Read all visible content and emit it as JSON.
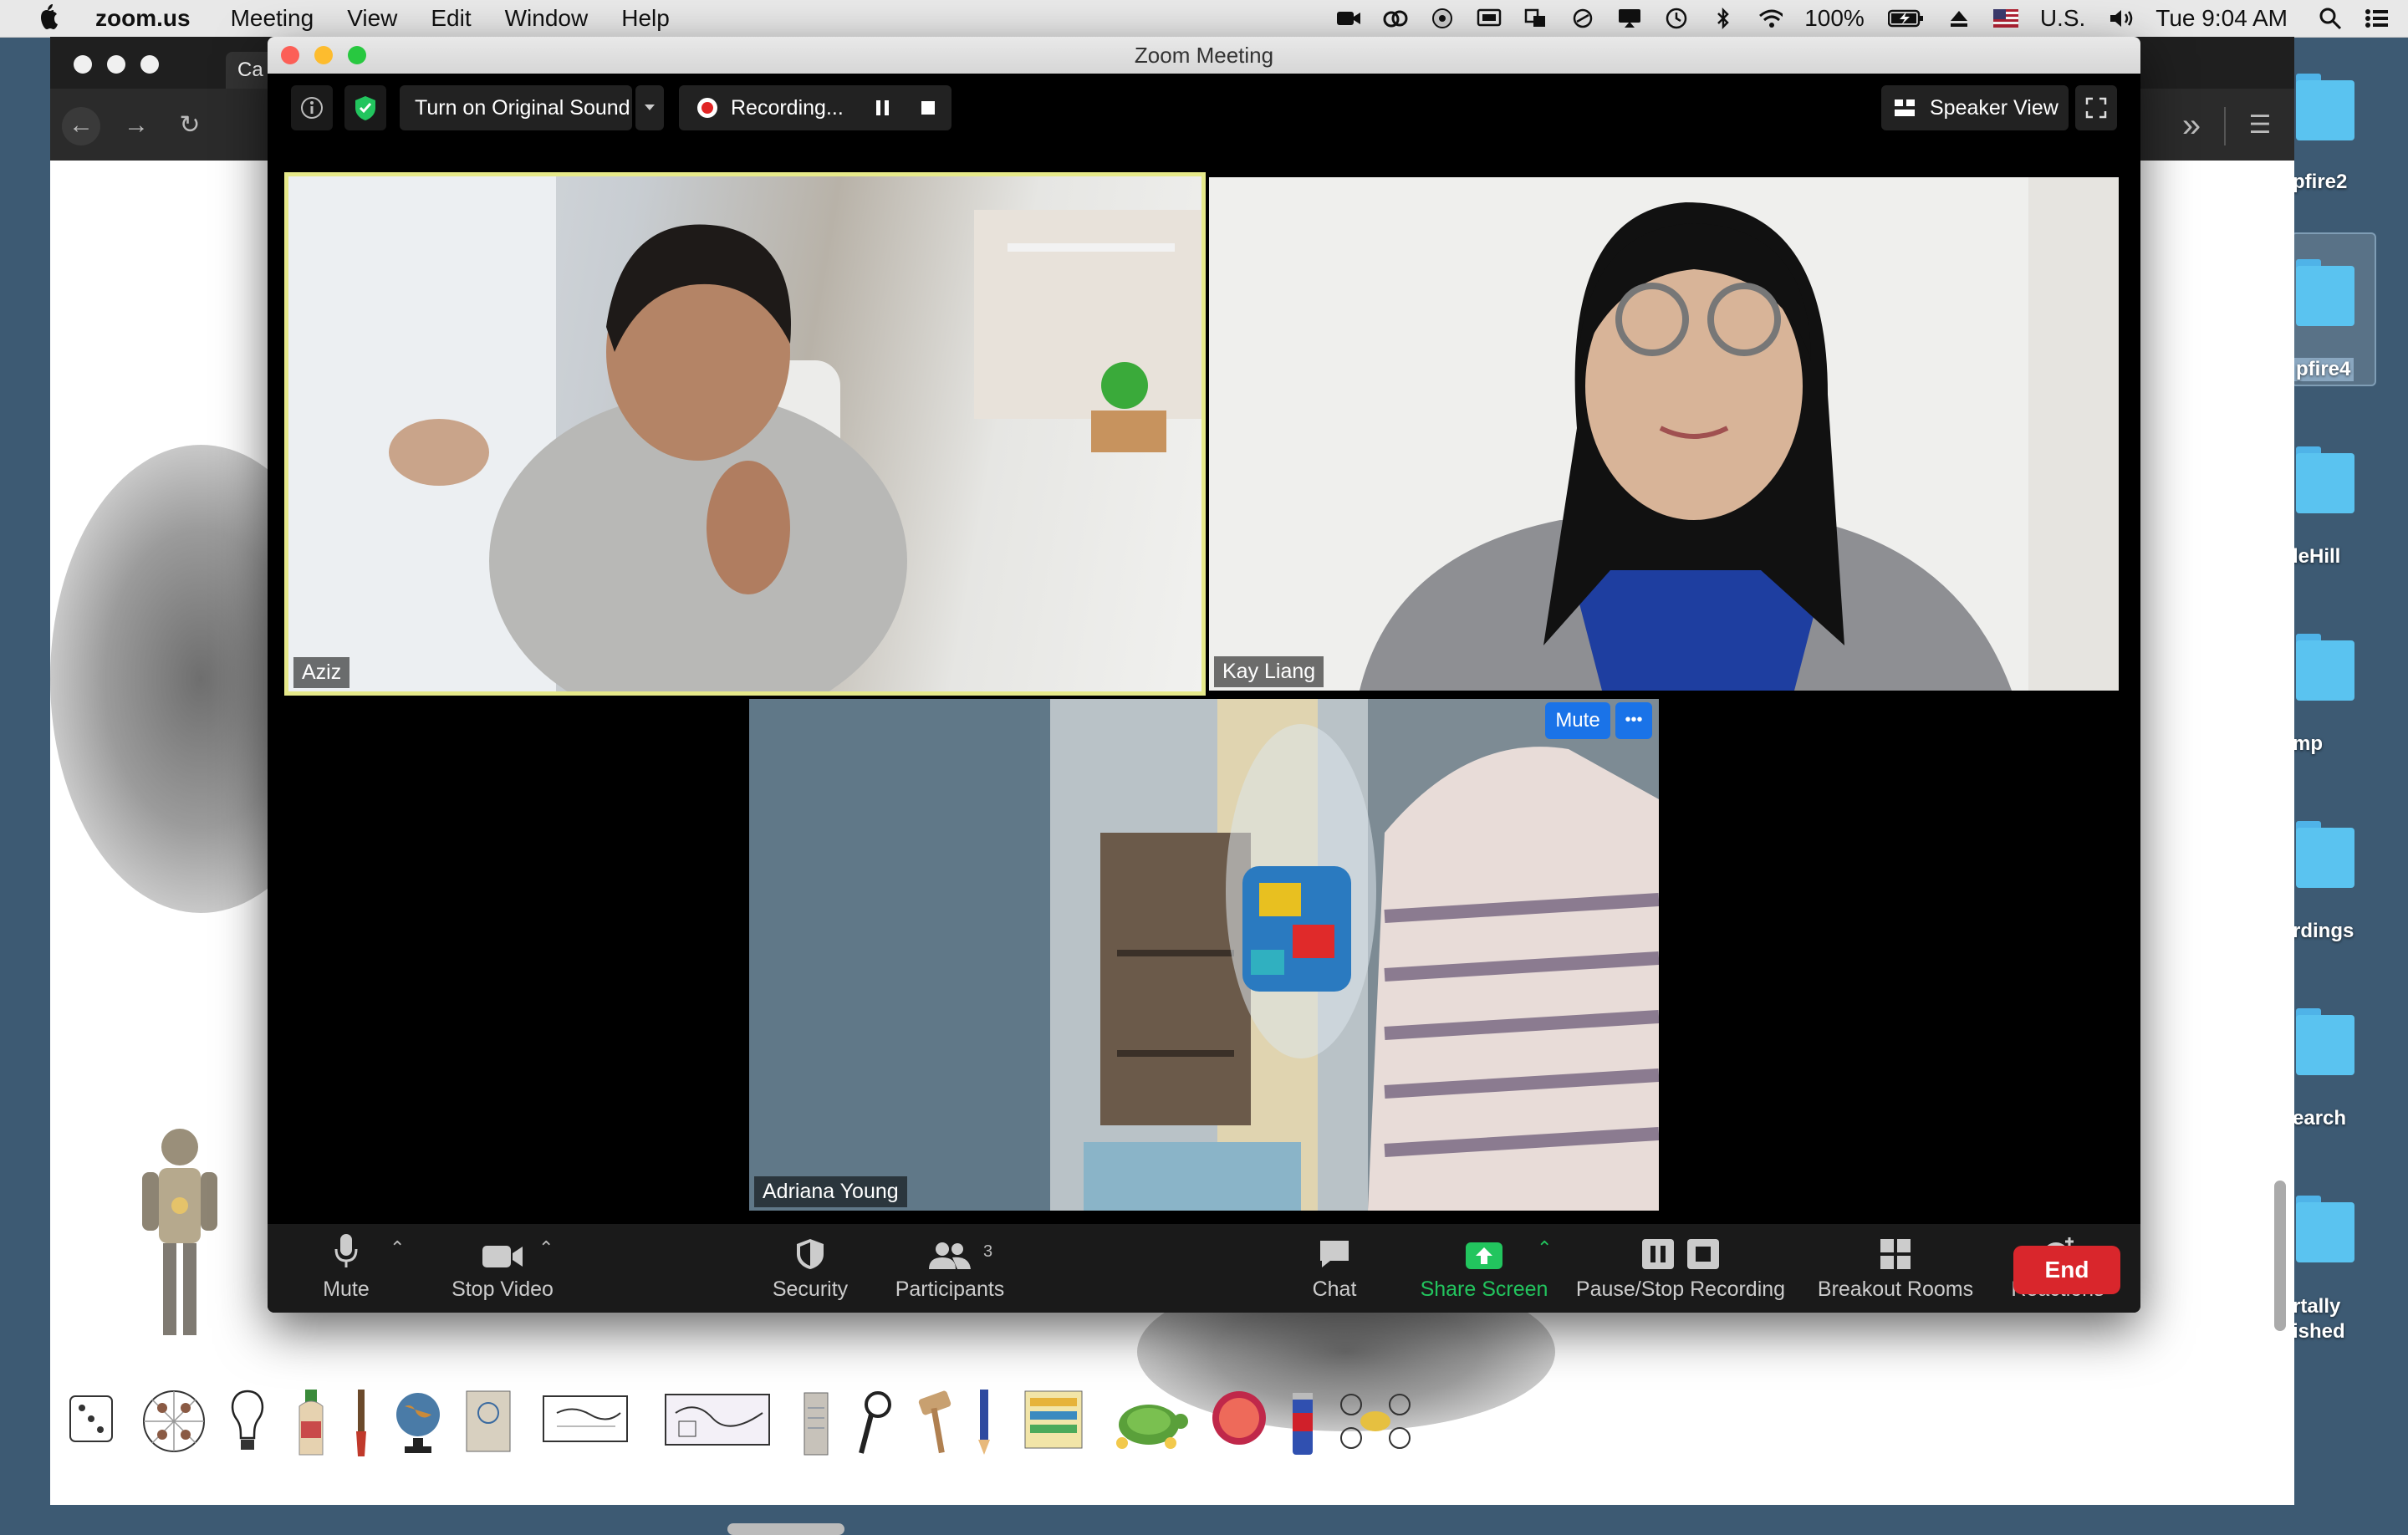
{
  "menubar": {
    "app_name": "zoom.us",
    "items": [
      "Meeting",
      "View",
      "Edit",
      "Window",
      "Help"
    ],
    "battery": "100%",
    "input_source": "U.S.",
    "clock": "Tue 9:04 AM"
  },
  "browser": {
    "tab_title": "Ca"
  },
  "desktop": {
    "folders": [
      "pfire2",
      "pfire4",
      "leHill",
      "mp",
      "rdings",
      "earch",
      "rtally\nished"
    ]
  },
  "zoom": {
    "window_title": "Zoom Meeting",
    "topbar": {
      "original_sound": "Turn on Original Sound",
      "recording": "Recording...",
      "speaker_view": "Speaker View"
    },
    "participants": [
      {
        "name": "Aziz",
        "active_speaker": true
      },
      {
        "name": "Kay Liang",
        "active_speaker": false
      },
      {
        "name": "Adriana Young",
        "active_speaker": false
      }
    ],
    "tile_buttons": {
      "mute": "Mute",
      "more": "•••"
    },
    "toolbar": {
      "mute": "Mute",
      "stop_video": "Stop Video",
      "security": "Security",
      "participants": "Participants",
      "participant_count": "3",
      "chat": "Chat",
      "share_screen": "Share Screen",
      "pause_stop_recording": "Pause/Stop Recording",
      "breakout_rooms": "Breakout Rooms",
      "reactions": "Reactions",
      "end": "End"
    },
    "colors": {
      "active_speaker_border": "#e6e98a",
      "share_green": "#22c55e",
      "end_red": "#d9262c",
      "mute_blue": "#1a73e8"
    }
  }
}
